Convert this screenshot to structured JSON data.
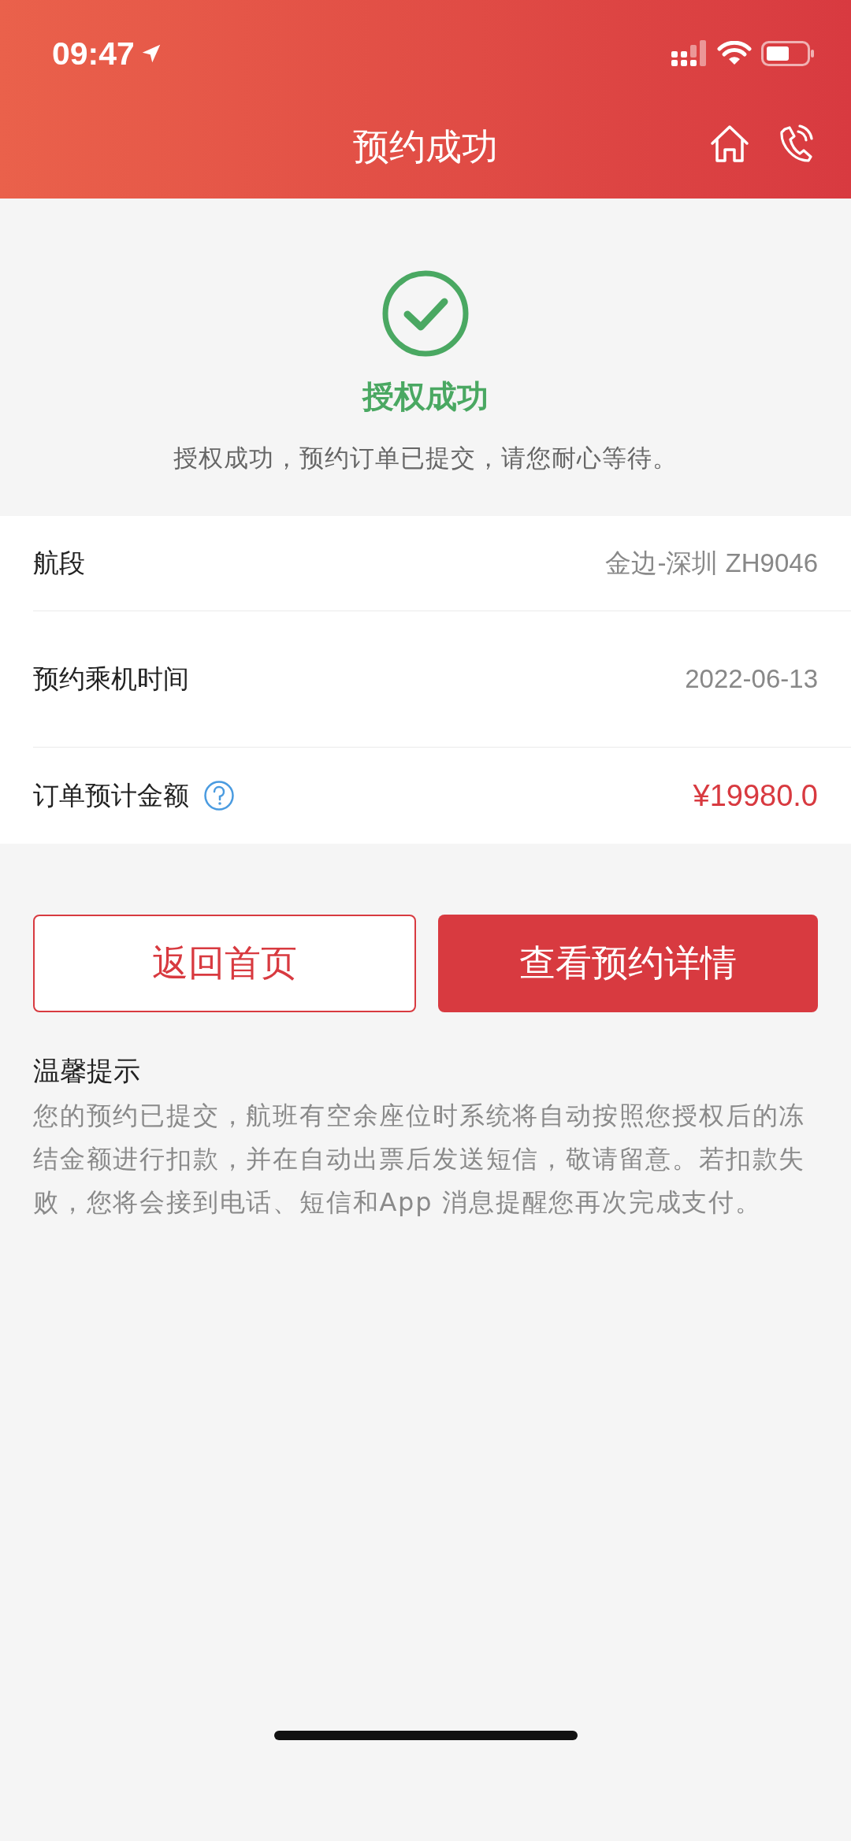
{
  "status_bar": {
    "time": "09:47"
  },
  "header": {
    "title": "预约成功"
  },
  "result": {
    "title": "授权成功",
    "message": "授权成功，预约订单已提交，请您耐心等待。"
  },
  "details": [
    {
      "label": "航段",
      "value": "金边-深圳 ZH9046",
      "kind": "plain",
      "help": false
    },
    {
      "label": "预约乘机时间",
      "value": "2022-06-13",
      "kind": "plain",
      "help": false
    },
    {
      "label": "订单预计金额",
      "value": "¥19980.0",
      "kind": "price",
      "help": true
    }
  ],
  "buttons": [
    {
      "label": "返回首页",
      "kind": "outline"
    },
    {
      "label": "查看预约详情",
      "kind": "primary"
    }
  ],
  "tips": {
    "title": "温馨提示",
    "text": "您的预约已提交，航班有空余座位时系统将自动按照您授权后的冻结金额进行扣款，并在自动出票后发送短信，敬请留意。若扣款失败，您将会接到电话、短信和App 消息提醒您再次完成支付。"
  }
}
